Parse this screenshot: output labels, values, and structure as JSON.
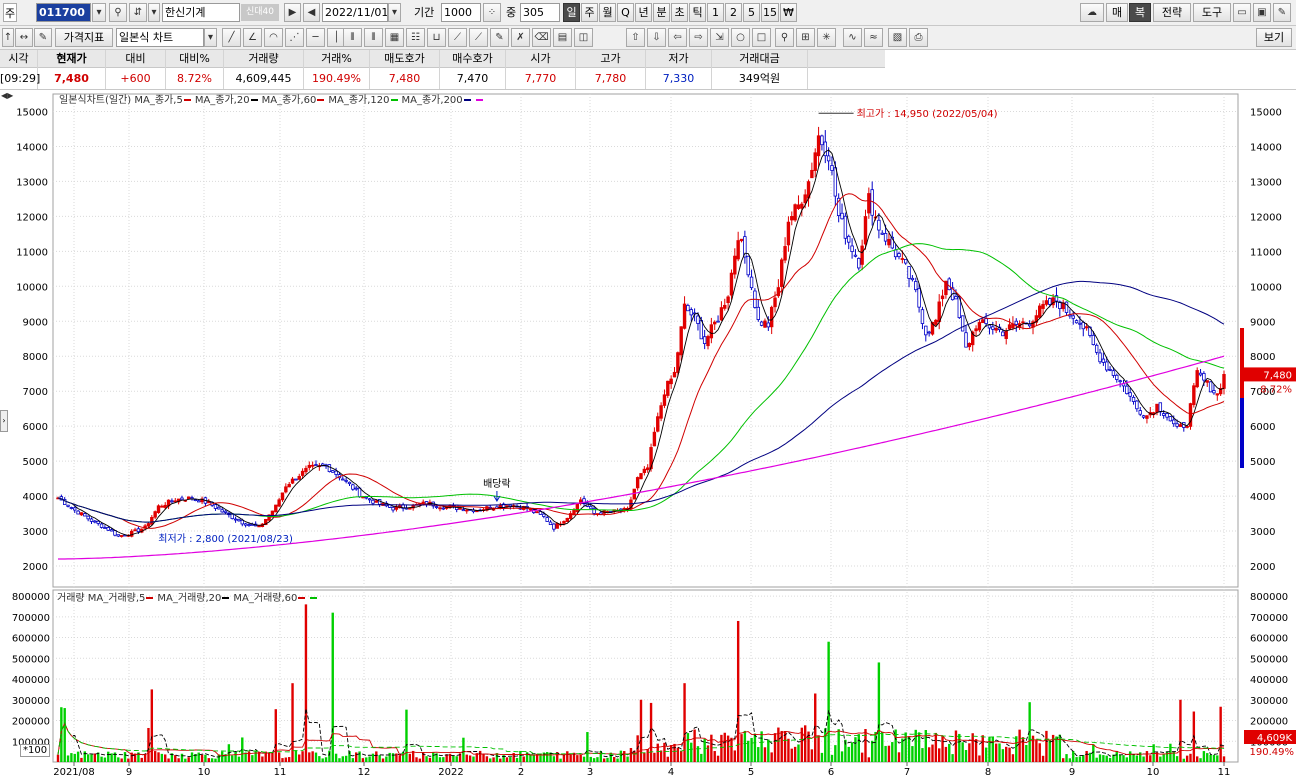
{
  "toolbar1": {
    "prefix": "주",
    "code": "011700",
    "name": "한신기계",
    "badge": "신대40",
    "date": "2022/11/01",
    "period_label": "기간",
    "period": "1000",
    "count_label": "중",
    "count": "305",
    "interval_buttons": [
      "일",
      "주",
      "월",
      "Q",
      "년",
      "분",
      "초",
      "틱",
      "1",
      "2",
      "5",
      "15",
      "₩"
    ],
    "right_buttons": [
      "매",
      "복",
      "전략",
      "도구"
    ]
  },
  "toolbar2": {
    "indicator_button": "가격지표",
    "chart_type": "일본식 차트",
    "view_button": "보기"
  },
  "quote": {
    "headers": [
      "시각",
      "현재가",
      "대비",
      "대비%",
      "거래량",
      "거래%",
      "매도호가",
      "매수호가",
      "시가",
      "고가",
      "저가",
      "거래대금"
    ],
    "values": [
      "[09:29]",
      "7,480",
      "+600",
      "8.72%",
      "4,609,445",
      "190.49%",
      "7,480",
      "7,470",
      "7,770",
      "7,780",
      "7,330",
      "349억원"
    ]
  },
  "legend": {
    "title": "일본식차트(일간)",
    "items": [
      {
        "label": "MA_종가,5",
        "color": "#d00000"
      },
      {
        "label": "MA_종가,20",
        "color": "#000000"
      },
      {
        "label": "MA_종가,60",
        "color": "#d00000"
      },
      {
        "label": "MA_종가,120",
        "color": "#00c000"
      },
      {
        "label": "MA_종가,200",
        "color": "#000080"
      },
      {
        "label": "",
        "color": "#e000e0"
      }
    ]
  },
  "volume_legend": {
    "title": "거래량",
    "items": [
      {
        "label": "MA_거래량,5",
        "color": "#d00000"
      },
      {
        "label": "MA_거래량,20",
        "color": "#000000"
      },
      {
        "label": "MA_거래량,60",
        "color": "#d00000"
      },
      {
        "label": "",
        "color": "#00c000"
      }
    ],
    "scale_button": "*100"
  },
  "chart_data": {
    "type": "candlestick",
    "price_axis": {
      "min": 1400,
      "max": 15500,
      "ticks": [
        2000,
        3000,
        4000,
        5000,
        6000,
        7000,
        8000,
        9000,
        10000,
        11000,
        12000,
        13000,
        14000,
        15000
      ]
    },
    "volume_axis": {
      "min": 0,
      "max": 810000,
      "ticks": [
        100000,
        200000,
        300000,
        400000,
        500000,
        600000,
        700000,
        800000
      ]
    },
    "x_labels": [
      "2021/08",
      "9",
      "10",
      "11",
      "12",
      "2022",
      "2",
      "3",
      "4",
      "5",
      "6",
      "7",
      "8",
      "9",
      "10",
      "11"
    ],
    "annotations": {
      "high": "최고가 : 14,950 (2022/05/04)",
      "low": "최저가 : 2,800 (2021/08/23)",
      "dividend": "배당락"
    },
    "last_price_tag": "7,480",
    "last_change_tag": "8.72%",
    "last_volume_tag": "4,609K",
    "last_volume_pct_tag": "190.49%",
    "close_path": [
      [
        0,
        3950
      ],
      [
        5,
        3600
      ],
      [
        10,
        3300
      ],
      [
        15,
        3050
      ],
      [
        18,
        2850
      ],
      [
        22,
        2950
      ],
      [
        26,
        3100
      ],
      [
        30,
        3700
      ],
      [
        35,
        3900
      ],
      [
        40,
        3950
      ],
      [
        45,
        3800
      ],
      [
        50,
        3500
      ],
      [
        55,
        3250
      ],
      [
        60,
        3100
      ],
      [
        65,
        3700
      ],
      [
        68,
        4300
      ],
      [
        72,
        4600
      ],
      [
        75,
        4800
      ],
      [
        80,
        4850
      ],
      [
        85,
        4500
      ],
      [
        90,
        4050
      ],
      [
        95,
        3800
      ],
      [
        100,
        3650
      ],
      [
        105,
        3700
      ],
      [
        110,
        3800
      ],
      [
        115,
        3700
      ],
      [
        120,
        3650
      ],
      [
        125,
        3600
      ],
      [
        130,
        3700
      ],
      [
        135,
        3750
      ],
      [
        140,
        3650
      ],
      [
        145,
        3400
      ],
      [
        148,
        3100
      ],
      [
        152,
        3400
      ],
      [
        156,
        3900
      ],
      [
        160,
        3500
      ],
      [
        165,
        3550
      ],
      [
        170,
        3600
      ],
      [
        173,
        4500
      ],
      [
        176,
        4800
      ],
      [
        178,
        5800
      ],
      [
        181,
        7000
      ],
      [
        184,
        7500
      ],
      [
        187,
        9400
      ],
      [
        190,
        9100
      ],
      [
        193,
        8400
      ],
      [
        197,
        9100
      ],
      [
        200,
        9800
      ],
      [
        203,
        11500
      ],
      [
        206,
        10500
      ],
      [
        209,
        9000
      ],
      [
        212,
        8900
      ],
      [
        215,
        10000
      ],
      [
        218,
        11900
      ],
      [
        221,
        12300
      ],
      [
        224,
        13000
      ],
      [
        227,
        14300
      ],
      [
        230,
        13800
      ],
      [
        233,
        12000
      ],
      [
        236,
        11300
      ],
      [
        239,
        10700
      ],
      [
        242,
        12500
      ],
      [
        245,
        11700
      ],
      [
        249,
        11100
      ],
      [
        253,
        10500
      ],
      [
        256,
        9800
      ],
      [
        259,
        8700
      ],
      [
        262,
        9000
      ],
      [
        265,
        10200
      ],
      [
        268,
        9500
      ],
      [
        271,
        8200
      ],
      [
        274,
        8900
      ],
      [
        277,
        8900
      ],
      [
        282,
        8700
      ],
      [
        286,
        8900
      ],
      [
        290,
        9000
      ],
      [
        294,
        9400
      ],
      [
        298,
        9600
      ],
      [
        301,
        9300
      ],
      [
        304,
        9100
      ],
      [
        307,
        8700
      ],
      [
        310,
        8100
      ],
      [
        313,
        7700
      ],
      [
        316,
        7400
      ],
      [
        319,
        7000
      ],
      [
        322,
        6500
      ],
      [
        325,
        6300
      ],
      [
        328,
        6600
      ],
      [
        331,
        6300
      ],
      [
        334,
        5900
      ],
      [
        337,
        6100
      ],
      [
        340,
        7500
      ],
      [
        343,
        7200
      ],
      [
        346,
        6900
      ],
      [
        348,
        7480
      ]
    ]
  }
}
